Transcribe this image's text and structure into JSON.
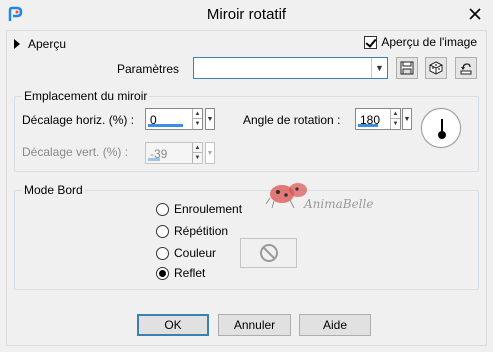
{
  "window": {
    "title": "Miroir rotatif"
  },
  "header": {
    "preview_label": "Aperçu",
    "preview_image_label": "Aperçu de l'image",
    "preview_image_checked": true
  },
  "presets": {
    "label": "Paramètres",
    "value": ""
  },
  "mirror_group": {
    "title": "Emplacement du miroir",
    "horiz_label": "Décalage horiz. (%) :",
    "horiz_value": "0",
    "vert_label": "Décalage vert. (%) :",
    "vert_value": "-39",
    "angle_label": "Angle de rotation :",
    "angle_value": "180"
  },
  "edge_group": {
    "title": "Mode Bord",
    "options": [
      "Enroulement",
      "Répétition",
      "Couleur",
      "Reflet"
    ],
    "selected": "Reflet"
  },
  "watermark": {
    "text": "AnimaBelle"
  },
  "buttons": {
    "ok": "OK",
    "cancel": "Annuler",
    "help": "Aide"
  },
  "colors": {
    "accent": "#3a8ee6",
    "focus_border": "#3c7fb1",
    "background": "#f0f0f0"
  },
  "icons": [
    "app-icon",
    "close-icon",
    "save-icon",
    "randomize-icon",
    "reset-icon",
    "no-color-icon",
    "ladybug-icon"
  ]
}
